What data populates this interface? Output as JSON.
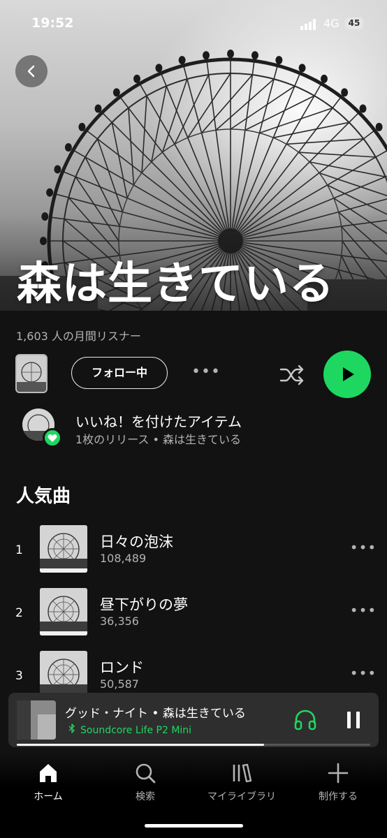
{
  "status": {
    "time": "19:52",
    "network": "4G",
    "battery": "45"
  },
  "artist": {
    "name": "森は生きている",
    "monthly_listeners": "1,603 人の月間リスナー",
    "follow_label": "フォロー中",
    "more_label": "•••"
  },
  "liked": {
    "title": "いいね！を付けたアイテム",
    "subtitle": "1枚のリリース • 森は生きている"
  },
  "popular": {
    "heading": "人気曲",
    "tracks": [
      {
        "rank": "1",
        "title": "日々の泡沫",
        "plays": "108,489"
      },
      {
        "rank": "2",
        "title": "昼下がりの夢",
        "plays": "36,356"
      },
      {
        "rank": "3",
        "title": "ロンド",
        "plays": "50,587"
      }
    ],
    "more_label": "•••"
  },
  "now_playing": {
    "title": "グッド・ナイト • 森は生きている",
    "device": "Soundcore Life P2 Mini",
    "progress": 0.7
  },
  "nav": {
    "items": [
      {
        "label": "ホーム",
        "icon": "home-icon",
        "active": true
      },
      {
        "label": "検索",
        "icon": "search-icon"
      },
      {
        "label": "マイライブラリ",
        "icon": "library-icon"
      },
      {
        "label": "制作する",
        "icon": "plus-icon"
      }
    ]
  },
  "colors": {
    "accent": "#1ed760",
    "background": "#121212",
    "surface": "#2e2e2e"
  }
}
